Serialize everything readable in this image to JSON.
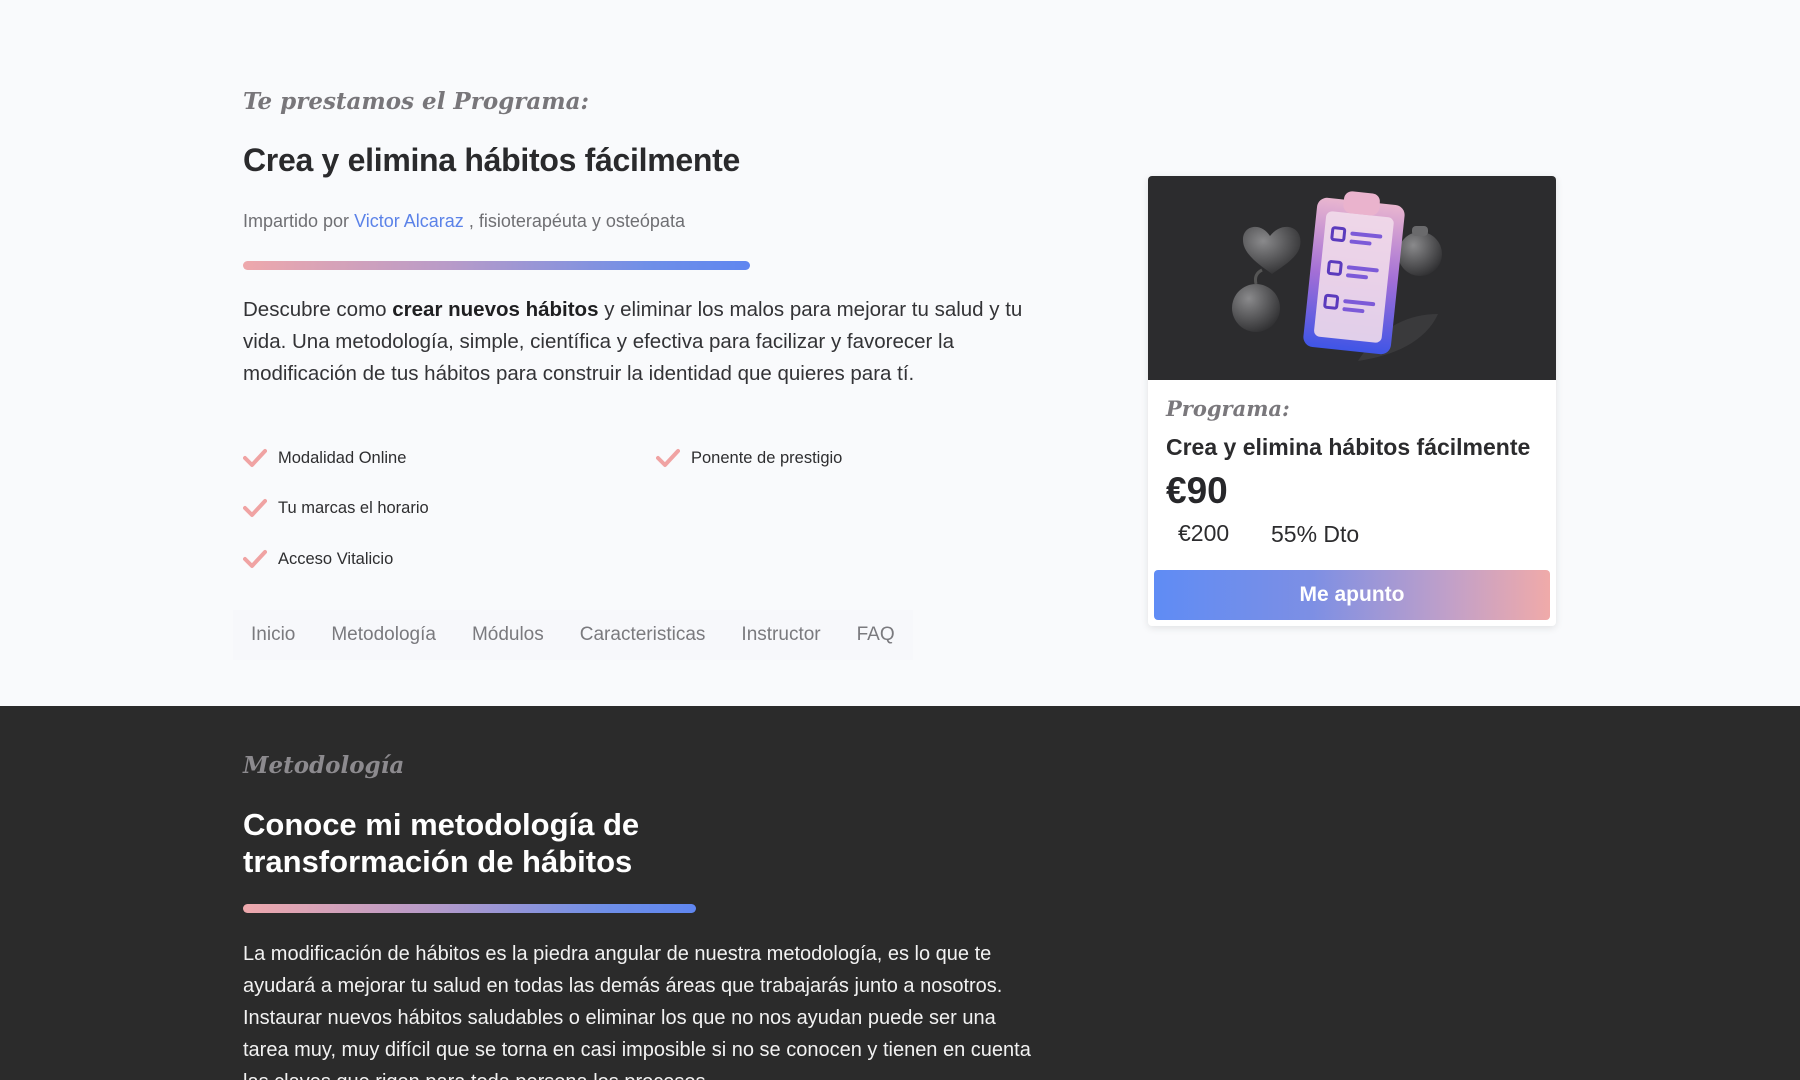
{
  "hero": {
    "eyebrow": "Te prestamos el Programa:",
    "title": "Crea y elimina hábitos fácilmente",
    "byline_prefix": "Impartido por",
    "instructor_name": "Victor Alcaraz",
    "byline_suffix": ", fisioterapéuta y osteópata",
    "lead_before": "Descubre como",
    "lead_bold": "crear nuevos hábitos",
    "lead_after": "y eliminar los malos para mejorar tu salud y tu vida. Una metodología, simple, científica y efectiva para facilizar y favorecer la modificación de tus hábitos para construir la identidad que quieres para tí.",
    "features": [
      {
        "label": "Modalidad Online",
        "icon": "check-icon"
      },
      {
        "label": "Tu marcas el horario",
        "icon": "check-icon"
      },
      {
        "label": "Acceso Vitalicio",
        "icon": "check-icon"
      },
      {
        "label": "Ponente de prestigio",
        "icon": "check-icon"
      }
    ]
  },
  "tabs": [
    {
      "label": "Inicio"
    },
    {
      "label": "Metodología"
    },
    {
      "label": "Módulos"
    },
    {
      "label": "Caracteristicas"
    },
    {
      "label": "Instructor"
    },
    {
      "label": "FAQ"
    }
  ],
  "card": {
    "image_icon": "habit-checklist-illustration",
    "eyebrow": "Programa:",
    "title": "Crea y elimina hábitos fácilmente",
    "price": "€90",
    "old_price": "€200",
    "discount": "55% Dto",
    "cta": "Me apunto"
  },
  "methodology": {
    "eyebrow": "Metodología",
    "title": "Conoce mi metodología de transformación de hábitos",
    "body": "La modificación de hábitos es la piedra angular de nuestra metodología, es lo que te ayudará a mejorar tu salud en todas las demás áreas que trabajarás junto a nosotros. Instaurar nuevos hábitos saludables o eliminar los que no nos ayudan puede ser una tarea muy, muy difícil que se torna en casi imposible si no se conocen y tienen en cuenta las claves que rigen para toda persona los procesos"
  },
  "colors": {
    "accent_blue": "#5f86f0",
    "accent_pink": "#eea8ac",
    "link": "#5b82e8",
    "dark_section": "#2b2b2b",
    "check": "#f0a3a3"
  }
}
